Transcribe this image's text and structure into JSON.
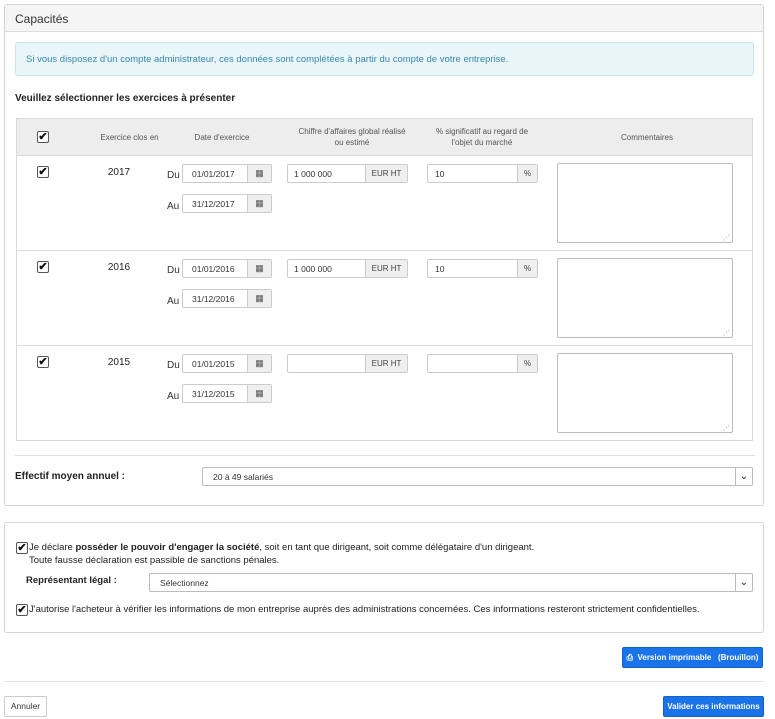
{
  "panel_title": "Capacités",
  "info_message": "Si vous disposez d'un compte administrateur, ces données sont complétées à partir du compte de votre entreprise.",
  "section_label": "Veuillez sélectionner les exercices à présenter",
  "table": {
    "headers": {
      "select_all_checked": true,
      "year": "Exercice clos en",
      "date": "Date d'exercice",
      "revenue_line1": "Chiffre d'affaires global réalisé",
      "revenue_line2": "ou estimé",
      "percent_line1": "% significatif au regard de",
      "percent_line2": "l'objet du marché",
      "comments": "Commentaires"
    },
    "from_label": "Du",
    "to_label": "Au",
    "currency_unit": "EUR HT",
    "percent_unit": "%",
    "rows": [
      {
        "checked": true,
        "year": "2017",
        "date_from": "01/01/2017",
        "date_to": "31/12/2017",
        "revenue": "1 000 000",
        "percent": "10",
        "comment": ""
      },
      {
        "checked": true,
        "year": "2016",
        "date_from": "01/01/2016",
        "date_to": "31/12/2016",
        "revenue": "1 000 000",
        "percent": "10",
        "comment": ""
      },
      {
        "checked": true,
        "year": "2015",
        "date_from": "01/01/2015",
        "date_to": "31/12/2015",
        "revenue": "",
        "percent": "",
        "comment": ""
      }
    ]
  },
  "effectif": {
    "label": "Effectif moyen annuel :",
    "selected": "20 à 49 salariés"
  },
  "declaration": {
    "checked": true,
    "prefix": "Je déclare ",
    "bold": "posséder le pouvoir d'engager la société",
    "suffix": ", soit en tant que dirigeant, soit comme délégataire d'un dirigeant.",
    "warning": "Toute fausse déclaration est passible de sanctions pénales."
  },
  "representant": {
    "label": "Représentant légal :",
    "selected": "Sélectionnez"
  },
  "authorization": {
    "checked": true,
    "text": "J'autorise l'acheteur à vérifier les informations de mon entreprise auprès des administrations concernées. Ces informations resteront strictement confidentielles."
  },
  "buttons": {
    "print": "Version imprimable",
    "print_suffix": "(Brouillon)",
    "cancel": "Annuler",
    "validate": "Valider ces informations"
  },
  "icons": {
    "calendar": "calendar-icon",
    "printer": "printer-icon",
    "checkbox": "checkbox-icon",
    "chevron": "chevron-down-icon"
  },
  "colors": {
    "primary": "#1a73e8",
    "info_bg": "#e8f6fa",
    "info_text": "#3a87ad"
  }
}
